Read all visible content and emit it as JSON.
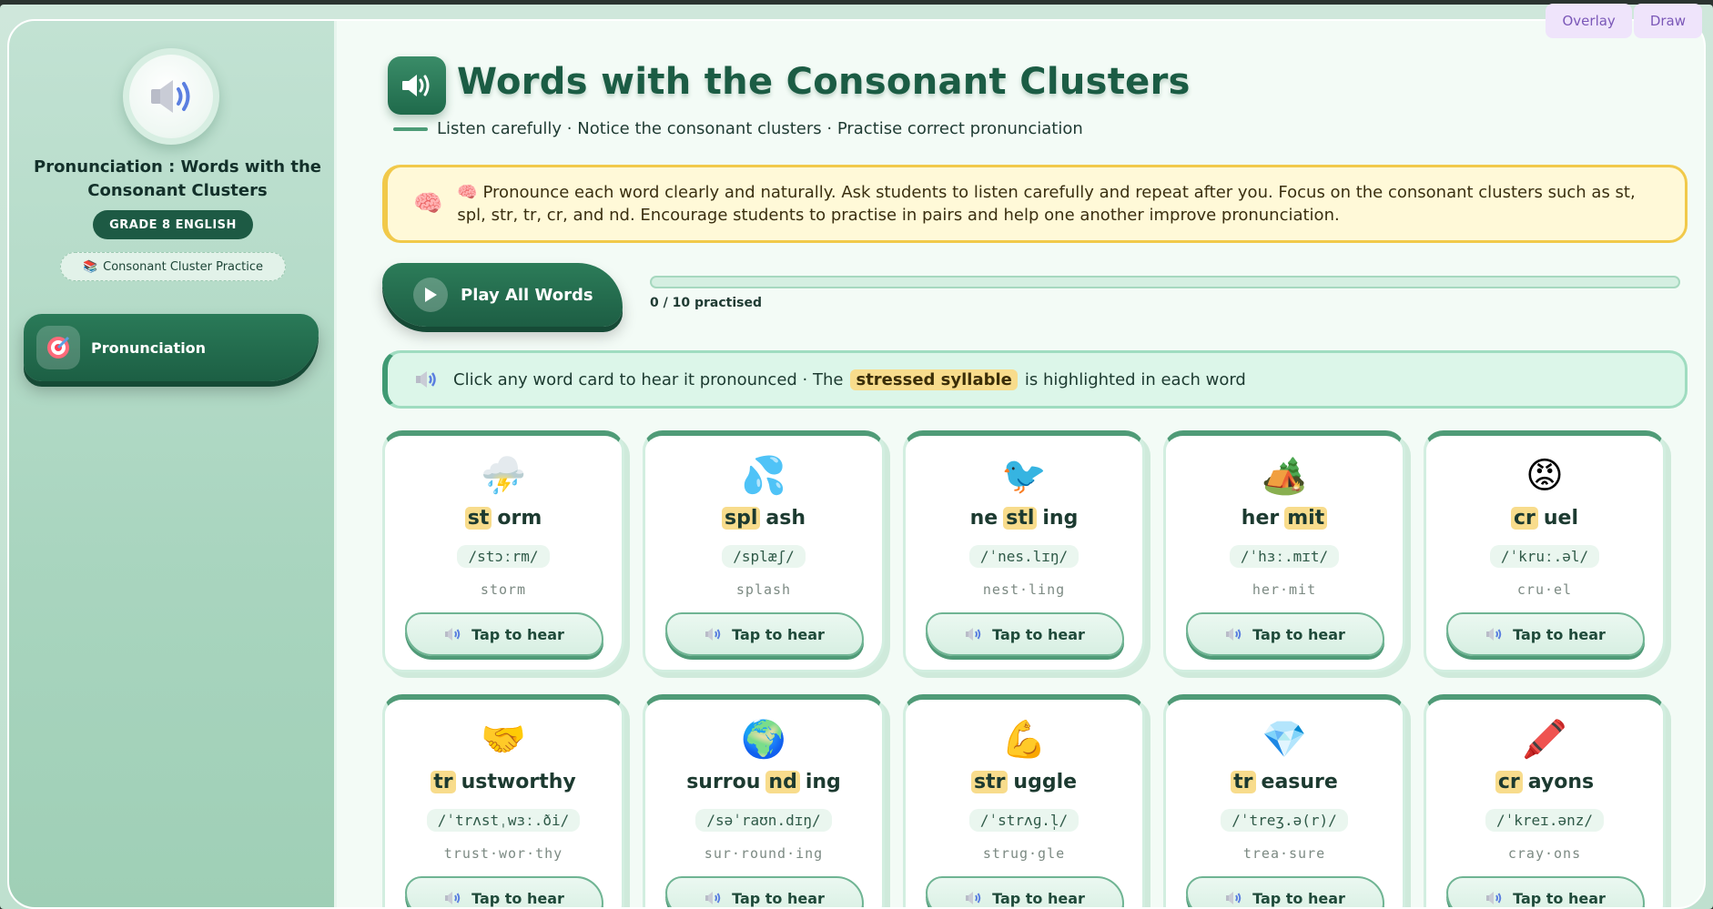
{
  "sidebar": {
    "title": "Pronunciation : Words with the Consonant Clusters",
    "grade": "GRADE 8 ENGLISH",
    "practice": "Consonant Cluster Practice",
    "nav": [
      {
        "label": "Pronunciation",
        "icon": "target-icon"
      }
    ]
  },
  "header": {
    "title": "Words with the Consonant Clusters",
    "subtitle": "Listen carefully · Notice the consonant clusters · Practise correct pronunciation"
  },
  "note": {
    "icon": "brain-icon",
    "text": "🧠 Pronounce each word clearly and naturally. Ask students to listen carefully and repeat after you. Focus on the consonant clusters such as st, spl, str, tr, cr, and nd. Encourage students to practise in pairs and help one another improve pronunciation."
  },
  "controls": {
    "play_all": "Play All Words",
    "progress_text": "0 / 10 practised",
    "progress_fraction": 0
  },
  "hint": {
    "before": "Click any word card to hear it pronounced · The",
    "chip": "stressed syllable",
    "after": "is highlighted in each word"
  },
  "tap_label": "Tap to hear",
  "words": [
    {
      "emoji": "⛈️",
      "parts": [
        "st",
        "orm"
      ],
      "hl": 0,
      "ipa": "/stɔːrm/",
      "syll": "storm"
    },
    {
      "emoji": "💦",
      "parts": [
        "spl",
        "ash"
      ],
      "hl": 0,
      "ipa": "/splæʃ/",
      "syll": "splash"
    },
    {
      "emoji": "🐦",
      "parts": [
        "ne",
        "stl",
        "ing"
      ],
      "hl": 1,
      "ipa": "/ˈnes.lɪŋ/",
      "syll": "nest·ling"
    },
    {
      "emoji": "🏕️",
      "parts": [
        "her",
        "mit"
      ],
      "hl": 1,
      "ipa": "/ˈhɜː.mɪt/",
      "syll": "her·mit"
    },
    {
      "emoji": "😡",
      "parts": [
        "cr",
        "uel"
      ],
      "hl": 0,
      "ipa": "/ˈkruː.əl/",
      "syll": "cru·el"
    },
    {
      "emoji": "🤝",
      "parts": [
        "tr",
        "ustworthy"
      ],
      "hl": 0,
      "ipa": "/ˈtrʌstˌwɜː.ði/",
      "syll": "trust·wor·thy"
    },
    {
      "emoji": "🌍",
      "parts": [
        "surrou",
        "nd",
        "ing"
      ],
      "hl": 1,
      "ipa": "/səˈraʊn.dɪŋ/",
      "syll": "sur·round·ing"
    },
    {
      "emoji": "💪",
      "parts": [
        "str",
        "uggle"
      ],
      "hl": 0,
      "ipa": "/ˈstrʌɡ.l̩/",
      "syll": "strug·gle"
    },
    {
      "emoji": "💎",
      "parts": [
        "tr",
        "easure"
      ],
      "hl": 0,
      "ipa": "/ˈtreʒ.ə(r)/",
      "syll": "trea·sure"
    },
    {
      "emoji": "🖍️",
      "parts": [
        "cr",
        "ayons"
      ],
      "hl": 0,
      "ipa": "/ˈkreɪ.ənz/",
      "syll": "cray·ons"
    }
  ],
  "overlay": {
    "overlay_label": "Overlay",
    "draw_label": "Draw"
  },
  "colors": {
    "primary": "#1d5a44",
    "highlight": "#f8dc8c",
    "note_border": "#f1c94a"
  }
}
